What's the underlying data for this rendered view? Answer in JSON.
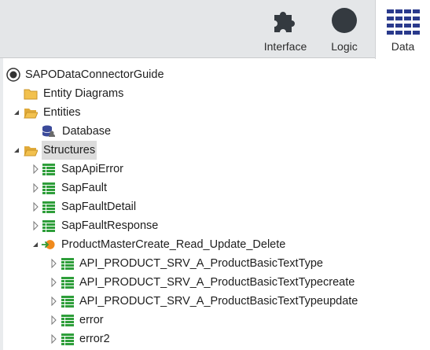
{
  "toolbar": {
    "tabs": [
      {
        "label": "Interface",
        "icon": "puzzle-icon"
      },
      {
        "label": "Logic",
        "icon": "circle-icon"
      },
      {
        "label": "Data",
        "icon": "grid-icon",
        "active": true
      }
    ]
  },
  "tree": {
    "root": "SAPODataConnectorGuide",
    "entity_diagrams": "Entity Diagrams",
    "entities": "Entities",
    "database": "Database",
    "structures": "Structures",
    "structure_items": [
      "SapApiError",
      "SapFault",
      "SapFaultDetail",
      "SapFaultResponse"
    ],
    "connector": "ProductMasterCreate_Read_Update_Delete",
    "connector_items": [
      "API_PRODUCT_SRV_A_ProductBasicTextType",
      "API_PRODUCT_SRV_A_ProductBasicTextTypecreate",
      "API_PRODUCT_SRV_A_ProductBasicTextTypeupdate",
      "error",
      "error2"
    ]
  },
  "colors": {
    "accent": "#2a3a8c",
    "folder": "#f2c14e",
    "structure_green": "#2e9e3a",
    "connector_orange": "#f08a1c"
  }
}
